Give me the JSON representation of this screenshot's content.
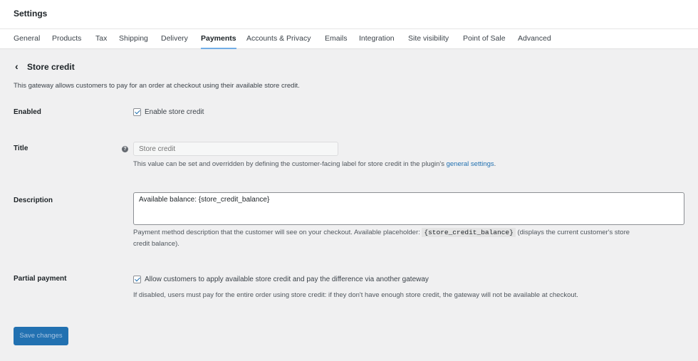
{
  "header": {
    "title": "Settings"
  },
  "tabs": [
    "General",
    "Products",
    "Tax",
    "Shipping",
    "Delivery",
    "Payments",
    "Accounts & Privacy",
    "Emails",
    "Integration",
    "Site visibility",
    "Point of Sale",
    "Advanced"
  ],
  "active_tab": "Payments",
  "page": {
    "title": "Store credit",
    "intro": "This gateway allows customers to pay for an order at checkout using their available store credit."
  },
  "enabled": {
    "label": "Enabled",
    "checkbox_label": "Enable store credit",
    "checked": true
  },
  "title_field": {
    "label": "Title",
    "placeholder": "Store credit",
    "help_before": "This value can be set and overridden by defining the customer-facing label for store credit in the plugin's ",
    "help_link": "general settings",
    "help_after": "."
  },
  "description": {
    "label": "Description",
    "value": "Available balance: {store_credit_balance}",
    "help_before": "Payment method description that the customer will see on your checkout. Available placeholder: ",
    "placeholder_code": "{store_credit_balance}",
    "help_after": " (displays the current customer's store",
    "help_line2": "credit balance)."
  },
  "partial": {
    "label": "Partial payment",
    "checkbox_label": "Allow customers to apply available store credit and pay the difference via another gateway",
    "checked": true,
    "help": "If disabled, users must pay for the entire order using store credit: if they don't have enough store credit, the gateway will not be available at checkout."
  },
  "save_label": "Save changes"
}
